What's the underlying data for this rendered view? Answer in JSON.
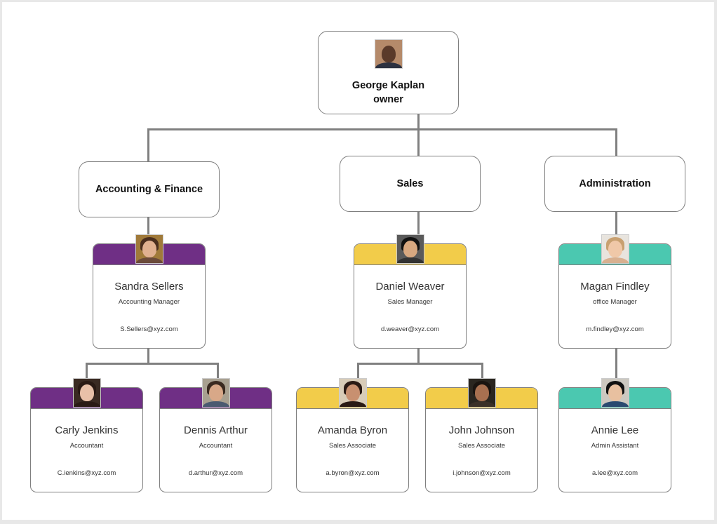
{
  "colors": {
    "accounting": "#6f2f85",
    "sales": "#f2cc4a",
    "administration": "#4bc8b0",
    "connector": "#808080"
  },
  "owner": {
    "name": "George Kaplan",
    "title": "owner",
    "photo": "portrait-photo"
  },
  "departments": [
    {
      "id": "accounting",
      "label": "Accounting & Finance"
    },
    {
      "id": "sales",
      "label": "Sales"
    },
    {
      "id": "administration",
      "label": "Administration"
    }
  ],
  "managers": [
    {
      "department": "accounting",
      "name": "Sandra Sellers",
      "role": "Accounting Manager",
      "email": "S.Sellers@xyz.com",
      "photo": "portrait-photo"
    },
    {
      "department": "sales",
      "name": "Daniel Weaver",
      "role": "Sales Manager",
      "email": "d.weaver@xyz.com",
      "photo": "portrait-photo"
    },
    {
      "department": "administration",
      "name": "Magan Findley",
      "role": "office Manager",
      "email": "m.findley@xyz.com",
      "photo": "portrait-photo"
    }
  ],
  "staff": [
    {
      "department": "accounting",
      "name": "Carly Jenkins",
      "role": "Accountant",
      "email": "C.ienkins@xyz.com",
      "photo": "portrait-photo"
    },
    {
      "department": "accounting",
      "name": "Dennis Arthur",
      "role": "Accountant",
      "email": "d.arthur@xyz.com",
      "photo": "portrait-photo"
    },
    {
      "department": "sales",
      "name": "Amanda Byron",
      "role": "Sales Associate",
      "email": "a.byron@xyz.com",
      "photo": "portrait-photo"
    },
    {
      "department": "sales",
      "name": "John Johnson",
      "role": "Sales Associate",
      "email": "i.johnson@xyz.com",
      "photo": "portrait-photo"
    },
    {
      "department": "administration",
      "name": "Annie Lee",
      "role": "Admin Assistant",
      "email": "a.lee@xyz.com",
      "photo": "portrait-photo"
    }
  ]
}
